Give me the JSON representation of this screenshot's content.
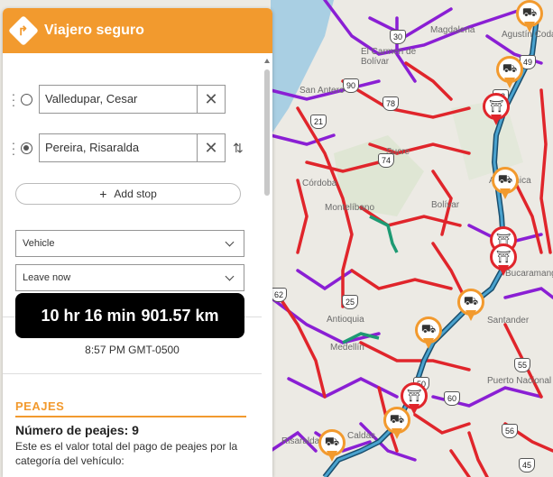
{
  "app": {
    "title": "Viajero seguro"
  },
  "stops": [
    {
      "value": "Valledupar, Cesar",
      "selected": false
    },
    {
      "value": "Pereira, Risaralda",
      "selected": true
    }
  ],
  "add_stop_label": "Add stop",
  "vehicle_select": "Vehicle",
  "departure_select": "Leave now",
  "route_summary": {
    "duration": "10 hr 16 min",
    "distance": "901.57 km"
  },
  "eta": "8:57 PM GMT-0500",
  "tolls": {
    "section_title": "PEAJES",
    "count_label": "Número de peajes:",
    "count_value": "9",
    "description": "Este es el valor total del pago de peajes por la categoría del vehículo:"
  },
  "map": {
    "labels": [
      "Magdalena",
      "El Carmen de Bolívar",
      "San Antero",
      "Sucre",
      "Córdoba",
      "Montelíbano",
      "Bolívar",
      "Antioquia",
      "Medellín",
      "Santander",
      "Caldas",
      "Risaralda",
      "Bucaramanga",
      "Agustín Codazzi",
      "Aguachica",
      "Puerto Nacional"
    ],
    "shields": [
      "90",
      "30",
      "49",
      "78",
      "43",
      "21",
      "74",
      "25",
      "62",
      "55",
      "60",
      "50",
      "45",
      "56"
    ],
    "colors": {
      "primary_roads": "#e0252b",
      "secondary_roads": "#8a1fd4",
      "route": "#2e7fa8",
      "accent": "#f29a2e"
    }
  }
}
